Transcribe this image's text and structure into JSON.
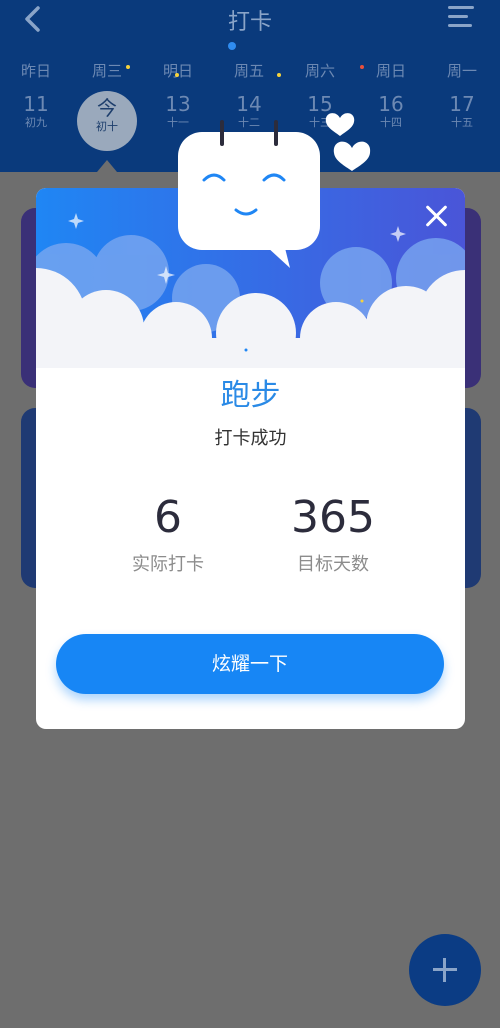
{
  "header": {
    "title": "打卡",
    "back_icon": "chevron-left-icon",
    "menu_icon": "menu-icon"
  },
  "weekdays": [
    "昨日",
    "周三",
    "明日",
    "周五",
    "周六",
    "周日",
    "周一"
  ],
  "dates": [
    {
      "num": "11",
      "lunar": "初九"
    },
    {
      "num": "今",
      "lunar": "初十"
    },
    {
      "num": "13",
      "lunar": "十一"
    },
    {
      "num": "14",
      "lunar": "十二"
    },
    {
      "num": "15",
      "lunar": "十三"
    },
    {
      "num": "16",
      "lunar": "十四"
    },
    {
      "num": "17",
      "lunar": "十五"
    }
  ],
  "colors": {
    "accent": "#1786f5",
    "habit_title": "#2a8ae6",
    "overlay": "#6e6e6e",
    "dot_yellow": "#f5d23c",
    "dot_red": "#e8503c"
  },
  "modal": {
    "habit_name": "跑步",
    "status": "打卡成功",
    "stats": [
      {
        "value": "6",
        "label": "实际打卡"
      },
      {
        "value": "365",
        "label": "目标天数"
      }
    ],
    "share_label": "炫耀一下",
    "close_icon": "close-icon",
    "mascot_icon": "calendar-mascot-icon"
  },
  "fab": {
    "icon": "plus-icon"
  }
}
